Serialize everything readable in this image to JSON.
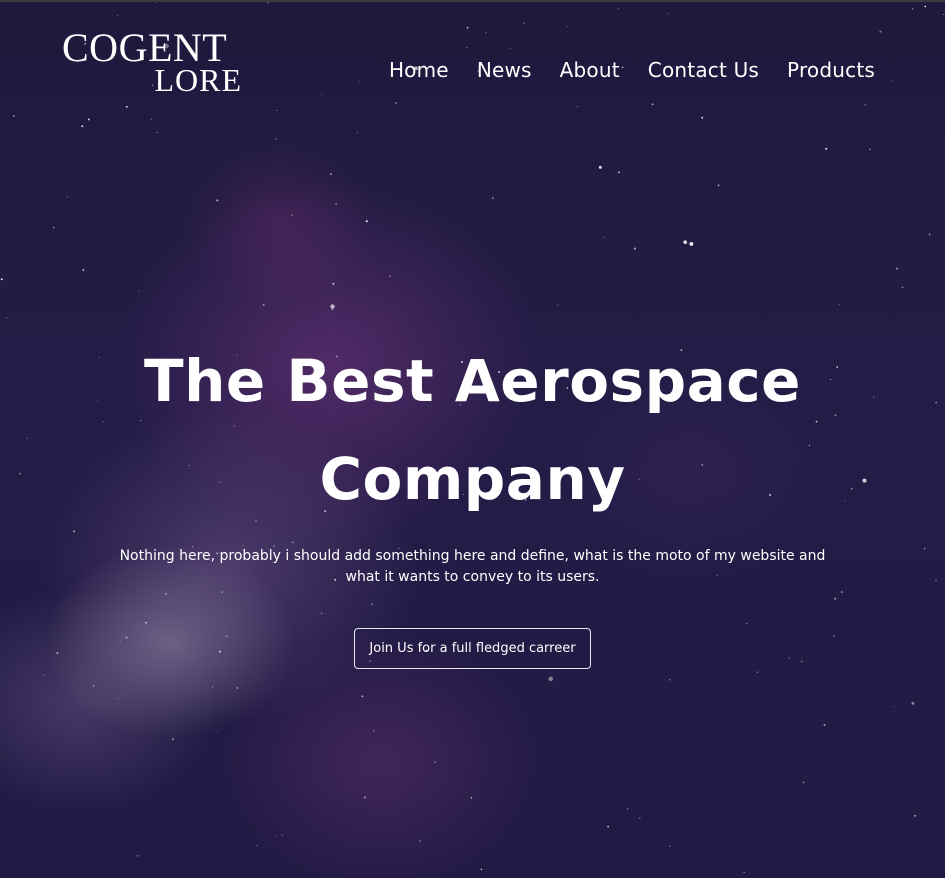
{
  "brand": {
    "logo_line1": "COGENT",
    "logo_line2": "LORE"
  },
  "nav": {
    "items": [
      "Home",
      "News",
      "About",
      "Contact Us",
      "Products"
    ]
  },
  "hero": {
    "title": "The Best Aerospace Company",
    "subtitle": "Nothing here, probably i should add something here and define, what is the moto of my website and what it wants to convey to its users.",
    "cta_label": "Join Us for a full fledged carreer"
  },
  "colors": {
    "background": "#221a44",
    "nebula": "#78378a",
    "text": "#ffffff",
    "button_border": "#e8e6f0"
  }
}
